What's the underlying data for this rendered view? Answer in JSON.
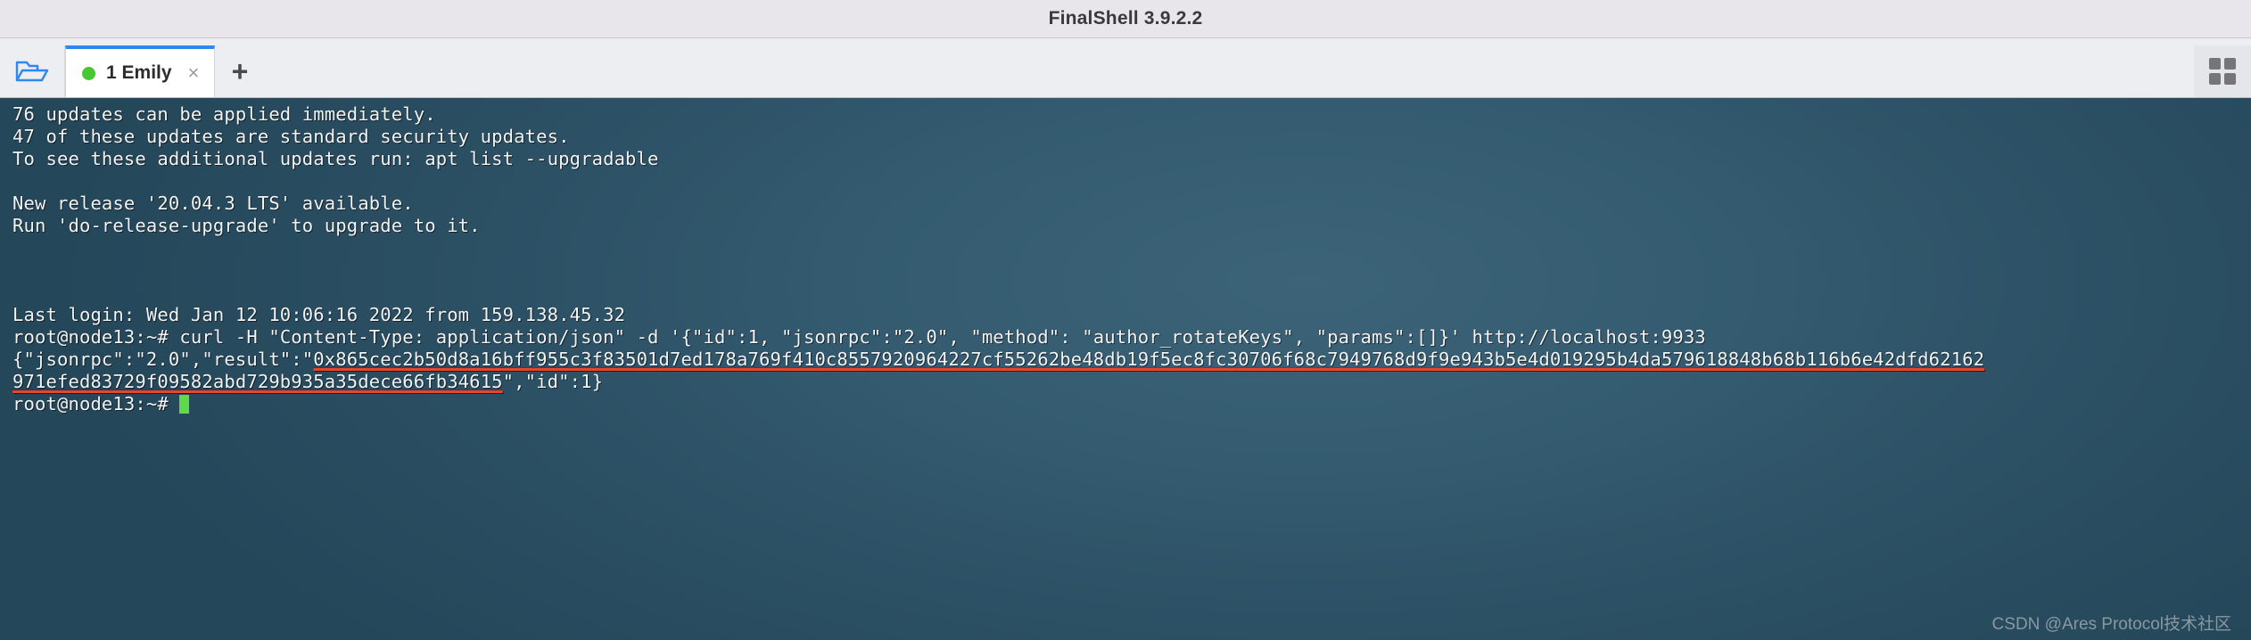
{
  "window": {
    "title": "FinalShell 3.9.2.2"
  },
  "toolbar": {
    "folder_icon": "folder-open-icon",
    "add_tab_label": "+",
    "grid_icon": "grid-layout-icon"
  },
  "tabs": [
    {
      "status_icon": "green-status-dot",
      "label": "1 Emily",
      "close_label": "×",
      "active": true
    }
  ],
  "terminal": {
    "prompt": "root@node13:~#",
    "cursor": "block-cursor",
    "lines": [
      {
        "id": "l01",
        "text": "76 updates can be applied immediately."
      },
      {
        "id": "l02",
        "text": "47 of these updates are standard security updates."
      },
      {
        "id": "l03",
        "text": "To see these additional updates run: apt list --upgradable"
      },
      {
        "id": "l04",
        "text": ""
      },
      {
        "id": "l05",
        "text": "New release '20.04.3 LTS' available."
      },
      {
        "id": "l06",
        "text": "Run 'do-release-upgrade' to upgrade to it."
      },
      {
        "id": "l07",
        "text": ""
      },
      {
        "id": "l08",
        "text": ""
      },
      {
        "id": "l09",
        "text": ""
      },
      {
        "id": "l10",
        "text": "Last login: Wed Jan 12 10:06:16 2022 from 159.138.45.32"
      }
    ],
    "command_line": {
      "prompt": "root@node13:~# ",
      "command": "curl -H \"Content-Type: application/json\" -d '{\"id\":1, \"jsonrpc\":\"2.0\", \"method\": \"author_rotateKeys\", \"params\":[]}' http://localhost:9933"
    },
    "response": {
      "prefix": "{\"jsonrpc\":\"2.0\",\"result\":\"",
      "hex_part1": "0x865cec2b50d8a16bff955c3f83501d7ed178a769f410c8557920964227cf55262be48db19f5ec8fc30706f68c7949768d9f9e943b5e4d019295b4da579618848b68b116b6e42dfd62162",
      "hex_part2": "971efed83729f09582abd729b935a35dece66fb34615",
      "suffix": "\",\"id\":1}",
      "underline_color": "#e8452b"
    },
    "final_prompt": "root@node13:~# "
  },
  "watermark": {
    "text": "CSDN @Ares Protocol技术社区"
  }
}
